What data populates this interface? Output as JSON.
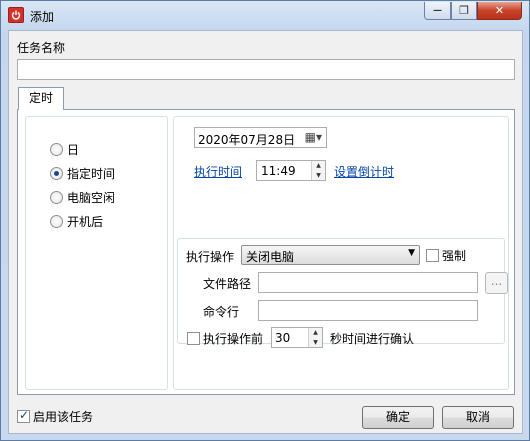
{
  "window": {
    "title": "添加",
    "min_label": "—",
    "max_label": "❐",
    "close_label": "✕"
  },
  "task_name": {
    "label": "任务名称",
    "value": ""
  },
  "tabs": [
    {
      "label": "定时"
    }
  ],
  "schedule": {
    "options": [
      {
        "label": "日",
        "checked": false
      },
      {
        "label": "指定时间",
        "checked": true
      },
      {
        "label": "电脑空闲",
        "checked": false
      },
      {
        "label": "开机后",
        "checked": false
      }
    ],
    "date_value": "2020年07月28日",
    "exec_time_link": "执行时间",
    "time_value": "11:49",
    "countdown_link": "设置倒计时"
  },
  "action": {
    "label": "执行操作",
    "selected": "关闭电脑",
    "force_label": "强制",
    "force_checked": false,
    "file_path_label": "文件路径",
    "file_path_value": "",
    "browse_label": "...",
    "command_label": "命令行",
    "command_value": "",
    "confirm_before_label": "执行操作前",
    "confirm_checked": false,
    "confirm_seconds": "30",
    "confirm_suffix": "秒时间进行确认"
  },
  "footer": {
    "enable_label": "启用该任务",
    "enable_checked": true,
    "ok_label": "确定",
    "cancel_label": "取消"
  }
}
